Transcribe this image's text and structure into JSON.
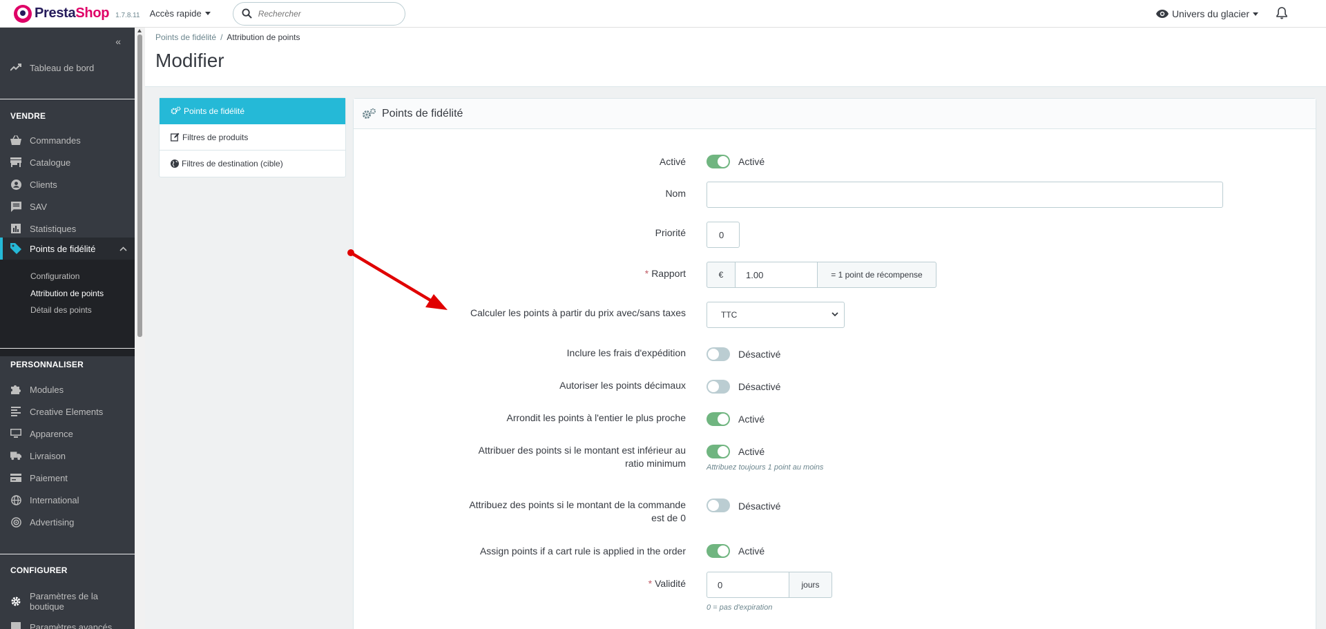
{
  "header": {
    "logo_text_a": "Presta",
    "logo_text_b": "Shop",
    "version": "1.7.8.11",
    "quick_access": "Accès rapide",
    "search_placeholder": "Rechercher",
    "shop_name": "Univers du glacier"
  },
  "sidebar": {
    "dashboard": "Tableau de bord",
    "sections": {
      "sell": "VENDRE",
      "customize": "PERSONNALISER",
      "configure": "CONFIGURER"
    },
    "sell_items": [
      "Commandes",
      "Catalogue",
      "Clients",
      "SAV",
      "Statistiques",
      "Points de fidélité"
    ],
    "loyalty_sub": [
      "Configuration",
      "Attribution de points",
      "Détail des points"
    ],
    "customize_items": [
      "Modules",
      "Creative Elements",
      "Apparence",
      "Livraison",
      "Paiement",
      "International",
      "Advertising"
    ],
    "configure_items": [
      "Paramètres de la boutique",
      "Paramètres avancés"
    ]
  },
  "breadcrumb": {
    "parent": "Points de fidélité",
    "separator": "/",
    "current": "Attribution de points"
  },
  "page_title": "Modifier",
  "tabs": [
    "Points de fidélité",
    "Filtres de produits",
    "Filtres de destination (cible)"
  ],
  "panel": {
    "title": "Points de fidélité",
    "fields": {
      "active_label": "Activé",
      "active_state": "Activé",
      "name_label": "Nom",
      "name_value": "",
      "priority_label": "Priorité",
      "priority_value": "0",
      "ratio_label": "Rapport",
      "ratio_currency": "€",
      "ratio_value": "1.00",
      "ratio_suffix": "= 1 point de récompense",
      "tax_label": "Calculer les points à partir du prix avec/sans taxes",
      "tax_value": "TTC",
      "shipping_label": "Inclure les frais d'expédition",
      "shipping_state": "Désactivé",
      "decimal_label": "Autoriser les points décimaux",
      "decimal_state": "Désactivé",
      "round_label": "Arrondit les points à l'entier le plus proche",
      "round_state": "Activé",
      "min_label_1": "Attribuer des points si le montant est inférieur au",
      "min_label_2": "ratio minimum",
      "min_state": "Activé",
      "min_help": "Attribuez toujours 1 point au moins",
      "zero_label_1": "Attribuez des points si le montant de la commande",
      "zero_label_2": "est de 0",
      "zero_state": "Désactivé",
      "cartrule_label": "Assign points if a cart rule is applied in the order",
      "cartrule_state": "Activé",
      "validity_label": "Validité",
      "validity_value": "0",
      "validity_suffix": "jours",
      "validity_help": "0 = pas d'expiration"
    }
  },
  "colors": {
    "accent": "#25b9d7",
    "switch_on": "#70b580",
    "switch_off": "#bbcdd2",
    "sidebar_bg": "#363a41",
    "annotation_arrow": "#e00000"
  }
}
